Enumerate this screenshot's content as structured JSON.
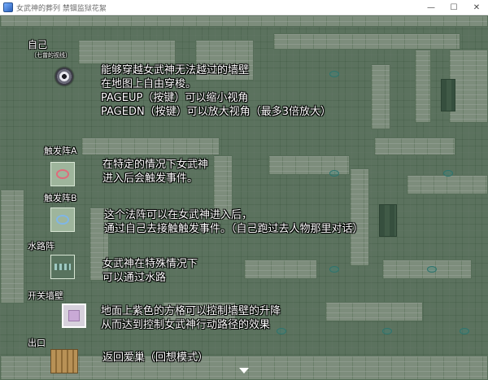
{
  "window": {
    "title": "女武神的葬列 禁锢监狱花絮",
    "controls": {
      "minimize": "—",
      "maximize": "☐",
      "close": "✕"
    }
  },
  "legend": {
    "self": {
      "label": "自己",
      "sublabel": "（七曾的视线）",
      "lines": [
        "能够穿越女武神无法越过的墙壁",
        "在地图上自由穿梭。",
        "PAGEUP（按键）可以缩小视角",
        "PAGEDN（按键）可以放大视角（最多3倍放大）"
      ]
    },
    "trigger_a": {
      "label": "触发阵A",
      "lines": [
        "在特定的情况下女武神",
        "进入后会触发事件。"
      ]
    },
    "trigger_b": {
      "label": "触发阵B",
      "lines": [
        "这个法阵可以在女武神进入后，",
        "通过自己去接触触发事件。（自己跑过去人物那里对话）"
      ]
    },
    "waterway": {
      "label": "水路阵",
      "lines": [
        "女武神在特殊情况下",
        "可以通过水路"
      ]
    },
    "wall_switch": {
      "label": "开关墙壁",
      "lines": [
        "地面上紫色的方格可以控制墙壁的升降",
        "从而达到控制女武神行动路径的效果"
      ]
    },
    "exit": {
      "label": "出口",
      "lines": [
        "返回爱巢（回想模式）"
      ]
    }
  },
  "icons": {
    "app": "game-app-icon",
    "self": "eye-icon",
    "trigger_a": "red-rune-icon",
    "trigger_b": "blue-rune-icon",
    "waterway": "waterway-icon",
    "wall_switch": "purple-switch-icon",
    "exit": "stairs-icon",
    "continue": "down-arrow-icon"
  },
  "colors": {
    "floor": "#86a389",
    "wall": "#b9ccb6",
    "text": "#ffffff",
    "trigger_a": "#e06a7a",
    "trigger_b": "#7fb6e8",
    "switch": "#c9a9d6"
  }
}
